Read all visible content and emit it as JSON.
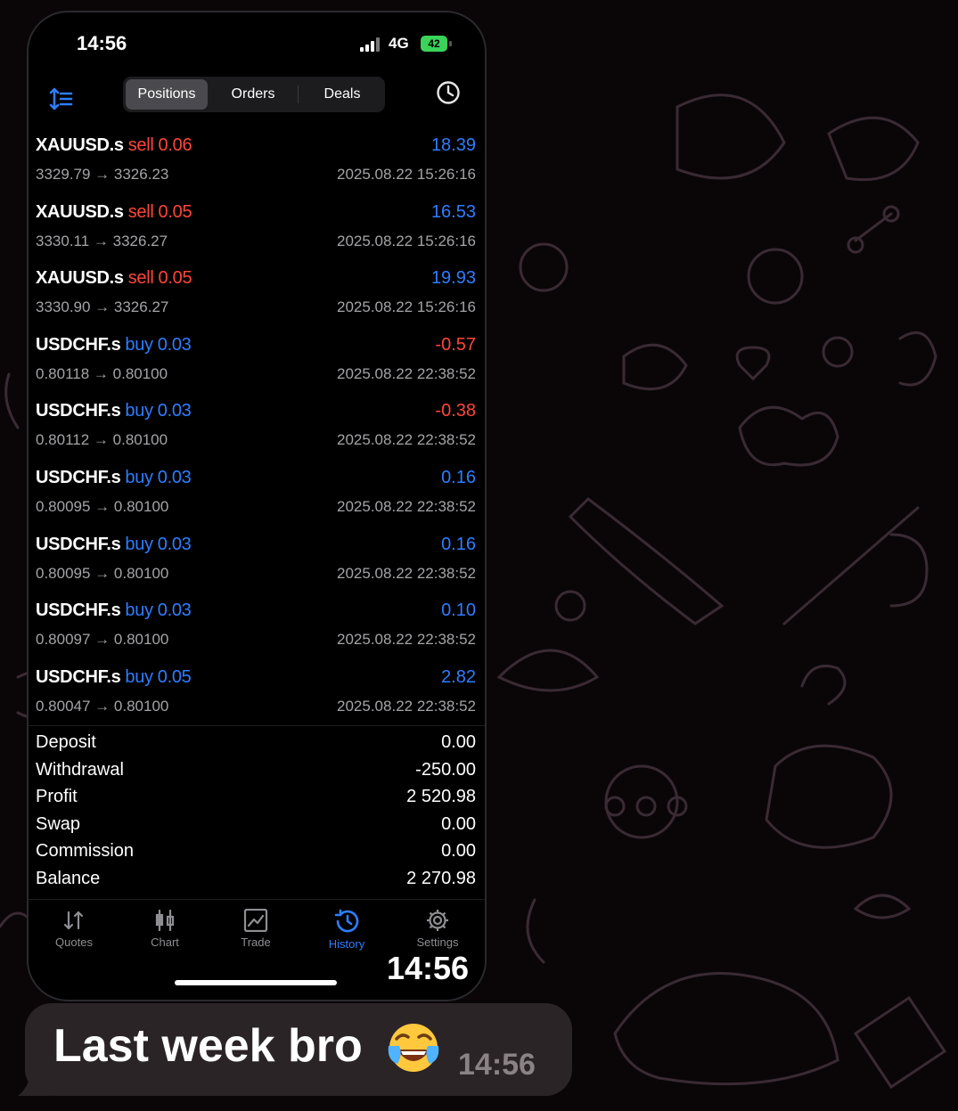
{
  "status_bar": {
    "time": "14:56",
    "network": "4G",
    "battery": "42"
  },
  "toolbar": {
    "tabs": [
      {
        "label": "Positions",
        "active": true
      },
      {
        "label": "Orders",
        "active": false
      },
      {
        "label": "Deals",
        "active": false
      }
    ]
  },
  "deals": [
    {
      "symbol": "XAUUSD.s",
      "side": "sell",
      "volume": "0.06",
      "prices": "3329.79 → 3326.23",
      "profit": "18.39",
      "time": "2025.08.22 15:26:16"
    },
    {
      "symbol": "XAUUSD.s",
      "side": "sell",
      "volume": "0.05",
      "prices": "3330.11 → 3326.27",
      "profit": "16.53",
      "time": "2025.08.22 15:26:16"
    },
    {
      "symbol": "XAUUSD.s",
      "side": "sell",
      "volume": "0.05",
      "prices": "3330.90 → 3326.27",
      "profit": "19.93",
      "time": "2025.08.22 15:26:16"
    },
    {
      "symbol": "USDCHF.s",
      "side": "buy",
      "volume": "0.03",
      "prices": "0.80118 → 0.80100",
      "profit": "-0.57",
      "time": "2025.08.22 22:38:52"
    },
    {
      "symbol": "USDCHF.s",
      "side": "buy",
      "volume": "0.03",
      "prices": "0.80112 → 0.80100",
      "profit": "-0.38",
      "time": "2025.08.22 22:38:52"
    },
    {
      "symbol": "USDCHF.s",
      "side": "buy",
      "volume": "0.03",
      "prices": "0.80095 → 0.80100",
      "profit": "0.16",
      "time": "2025.08.22 22:38:52"
    },
    {
      "symbol": "USDCHF.s",
      "side": "buy",
      "volume": "0.03",
      "prices": "0.80095 → 0.80100",
      "profit": "0.16",
      "time": "2025.08.22 22:38:52"
    },
    {
      "symbol": "USDCHF.s",
      "side": "buy",
      "volume": "0.03",
      "prices": "0.80097 → 0.80100",
      "profit": "0.10",
      "time": "2025.08.22 22:38:52"
    },
    {
      "symbol": "USDCHF.s",
      "side": "buy",
      "volume": "0.05",
      "prices": "0.80047 → 0.80100",
      "profit": "2.82",
      "time": "2025.08.22 22:38:52"
    }
  ],
  "summary": [
    {
      "label": "Deposit",
      "value": "0.00"
    },
    {
      "label": "Withdrawal",
      "value": "-250.00"
    },
    {
      "label": "Profit",
      "value": "2 520.98"
    },
    {
      "label": "Swap",
      "value": "0.00"
    },
    {
      "label": "Commission",
      "value": "0.00"
    },
    {
      "label": "Balance",
      "value": "2 270.98"
    }
  ],
  "tabbar": [
    {
      "label": "Quotes",
      "icon": "quotes-arrows-icon",
      "active": false
    },
    {
      "label": "Chart",
      "icon": "candlestick-icon",
      "active": false
    },
    {
      "label": "Trade",
      "icon": "trade-chart-icon",
      "active": false
    },
    {
      "label": "History",
      "icon": "history-clock-icon",
      "active": true
    },
    {
      "label": "Settings",
      "icon": "gear-icon",
      "active": false
    }
  ],
  "overlay_time": "14:56",
  "message": {
    "text": "Last week bro",
    "emoji": "face-with-tears-of-joy",
    "time": "14:56"
  },
  "colors": {
    "accent_blue": "#2f7dff",
    "sell_red": "#ff453a",
    "bubble_bg": "#2b2427",
    "chat_doodle": "#3a2a33"
  }
}
